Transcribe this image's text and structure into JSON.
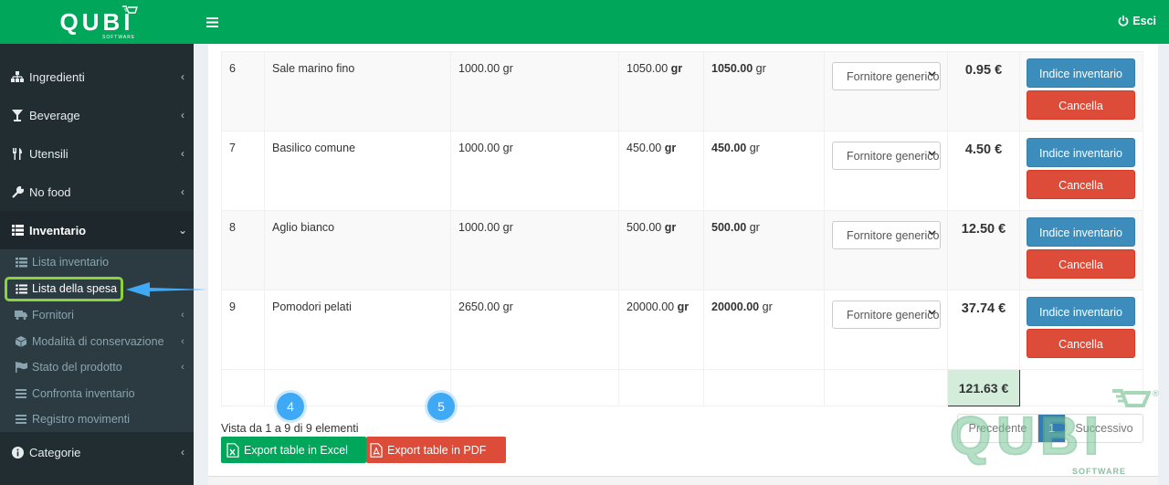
{
  "brand": {
    "logo_text": "QUBI",
    "logo_sub": "SOFTWARE",
    "registered": "®"
  },
  "header": {
    "logout_label": "Esci"
  },
  "sidebar": {
    "items": [
      {
        "label": "Ingredienti",
        "icon": "sitemap-icon"
      },
      {
        "label": "Beverage",
        "icon": "glass-icon"
      },
      {
        "label": "Utensili",
        "icon": "cutlery-icon"
      },
      {
        "label": "No food",
        "icon": "wrench-icon"
      },
      {
        "label": "Inventario",
        "icon": "list-icon"
      },
      {
        "label": "Categorie",
        "icon": "circle-info-icon"
      }
    ],
    "sub_items": [
      {
        "label": "Lista inventario",
        "icon": "list-icon"
      },
      {
        "label": "Lista della spesa",
        "icon": "list-ul-icon"
      },
      {
        "label": "Fornitori",
        "icon": "truck-icon"
      },
      {
        "label": "Modalità di conservazione",
        "icon": "cube-icon"
      },
      {
        "label": "Stato del prodotto",
        "icon": "flag-icon"
      },
      {
        "label": "Confronta inventario",
        "icon": "bars-icon"
      },
      {
        "label": "Registro movimenti",
        "icon": "bars-icon"
      }
    ]
  },
  "table": {
    "rows": [
      {
        "id": "6",
        "name": "Sale marino fino",
        "qty": "1000.00 gr",
        "need_num": "1050.00",
        "need_unit": "gr",
        "buy_num": "1050.00",
        "buy_unit": "gr",
        "supplier": "Fornitore generico",
        "price": "0.95 €"
      },
      {
        "id": "7",
        "name": "Basilico comune",
        "qty": "1000.00 gr",
        "need_num": "450.00",
        "need_unit": "gr",
        "buy_num": "450.00",
        "buy_unit": "gr",
        "supplier": "Fornitore generico",
        "price": "4.50 €"
      },
      {
        "id": "8",
        "name": "Aglio bianco",
        "qty": "1000.00 gr",
        "need_num": "500.00",
        "need_unit": "gr",
        "buy_num": "500.00",
        "buy_unit": "gr",
        "supplier": "Fornitore generico",
        "price": "12.50 €"
      },
      {
        "id": "9",
        "name": "Pomodori pelati",
        "qty": "2650.00 gr",
        "need_num": "20000.00",
        "need_unit": "gr",
        "buy_num": "20000.00",
        "buy_unit": "gr",
        "supplier": "Fornitore generico",
        "price": "37.74 €"
      }
    ],
    "btn_inventory": "Indice inventario",
    "btn_delete": "Cancella",
    "total": "121.63 €"
  },
  "footer": {
    "info": "Vista da 1 a 9 di 9 elementi",
    "export_excel": "Export table in Excel",
    "export_pdf": "Export table in PDF",
    "step_excel": "4",
    "step_pdf": "5",
    "pager": {
      "prev": "Precedente",
      "page": "1",
      "next": "Successivo"
    }
  }
}
